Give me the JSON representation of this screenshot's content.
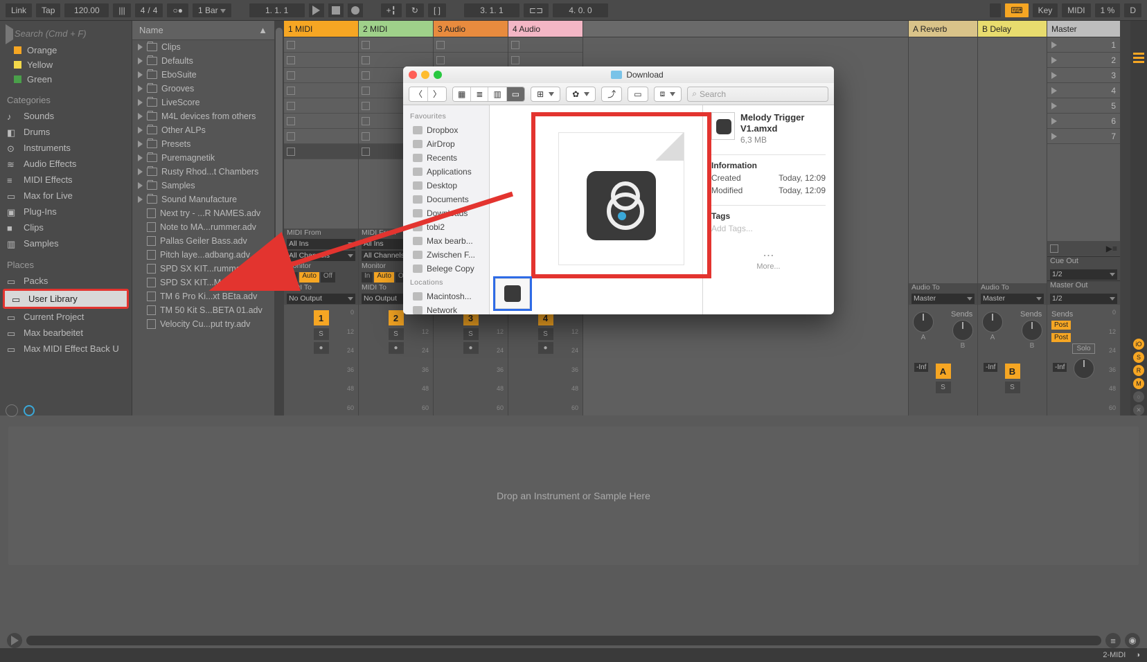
{
  "toolbar": {
    "link": "Link",
    "tap": "Tap",
    "tempo": "120.00",
    "sig_num": "4",
    "sig_den": "4",
    "quantize": "1 Bar",
    "position": "1.   1.   1",
    "arr_pos": "3.   1.   1",
    "loop_len": "4.   0.   0",
    "key": "Key",
    "midi": "MIDI",
    "cpu": "1 %",
    "d": "D"
  },
  "browser": {
    "search_placeholder": "Search (Cmd + F)",
    "tags": [
      {
        "label": "Orange",
        "color": "#f6a623"
      },
      {
        "label": "Yellow",
        "color": "#f3d94a"
      },
      {
        "label": "Green",
        "color": "#4aa04a"
      }
    ],
    "categories_hdr": "Categories",
    "categories": [
      "Sounds",
      "Drums",
      "Instruments",
      "Audio Effects",
      "MIDI Effects",
      "Max for Live",
      "Plug-Ins",
      "Clips",
      "Samples"
    ],
    "places_hdr": "Places",
    "places": [
      "Packs",
      "User Library",
      "Current Project",
      "Max bearbeitet",
      "Max MIDI Effect Back U"
    ],
    "places_highlight_index": 1,
    "name_hdr": "Name",
    "folders": [
      "Clips",
      "Defaults",
      "EboSuite",
      "Grooves",
      "LiveScore",
      "M4L devices from others",
      "Other ALPs",
      "Presets",
      "Puremagnetik",
      "Rusty Rhod...t Chambers",
      "Samples",
      "Sound Manufacture"
    ],
    "files": [
      "Next try - ...R NAMES.adv",
      "Note to MA...rummer.adv",
      "Pallas  Geiler Bass.adv",
      "Pitch laye...adbang.adv",
      "SPD SX KIT...rummer.adv",
      "SPD SX KIT...MATION.adv",
      "TM 6 Pro Ki...xt BEta.adv",
      "TM 50 Kit S...BETA 01.adv",
      "Velocity Cu...put try.adv"
    ]
  },
  "tracks": [
    {
      "name": "1 MIDI",
      "color": "#f6a623",
      "num": "1"
    },
    {
      "name": "2 MIDI",
      "color": "#9fd18a",
      "num": "2"
    },
    {
      "name": "3 Audio",
      "color": "#e88b3e",
      "num": "3"
    },
    {
      "name": "4 Audio",
      "color": "#f3b6c5",
      "num": "4"
    }
  ],
  "returns": [
    {
      "name": "A Reverb",
      "color": "#d9c389",
      "letter": "A"
    },
    {
      "name": "B Delay",
      "color": "#e8dc6e",
      "letter": "B"
    }
  ],
  "master": {
    "name": "Master",
    "color": "#bdbdbd"
  },
  "routing": {
    "midi_from": "MIDI From",
    "all_ins": "All Ins",
    "all_ch": "All Channels",
    "monitor": "Monitor",
    "in": "In",
    "auto": "Auto",
    "off": "Off",
    "midi_to": "MIDI To",
    "no_output": "No Output",
    "audio_to": "Audio To",
    "master": "Master",
    "cue_out": "Cue Out",
    "cue_val": "1/2",
    "master_out": "Master Out",
    "master_val": "1/2",
    "sends": "Sends",
    "post": "Post",
    "solo": "Solo",
    "inf": "-Inf",
    "s": "S",
    "rec": "●"
  },
  "scenes": [
    "1",
    "2",
    "3",
    "4",
    "5",
    "6",
    "7"
  ],
  "meter_ticks": [
    "0",
    "12",
    "24",
    "36",
    "48",
    "60"
  ],
  "drop_text": "Drop an Instrument or Sample Here",
  "status": {
    "mode": "2-MIDI"
  },
  "finder": {
    "title": "Download",
    "search_placeholder": "Search",
    "sidebar": {
      "fav_hdr": "Favourites",
      "fav": [
        "Dropbox",
        "AirDrop",
        "Recents",
        "Applications",
        "Desktop",
        "Documents",
        "Downloads",
        "tobi2",
        "Max bearb...",
        "Zwischen F...",
        "Belege Copy"
      ],
      "loc_hdr": "Locations",
      "loc": [
        "Macintosh...",
        "Network"
      ]
    },
    "file": {
      "name": "Melody Trigger V1.amxd",
      "size": "6,3 MB"
    },
    "info": {
      "hdr": "Information",
      "created_lbl": "Created",
      "created_val": "Today, 12:09",
      "modified_lbl": "Modified",
      "modified_val": "Today, 12:09",
      "tags_hdr": "Tags",
      "tags_placeholder": "Add Tags...",
      "more": "More..."
    }
  }
}
